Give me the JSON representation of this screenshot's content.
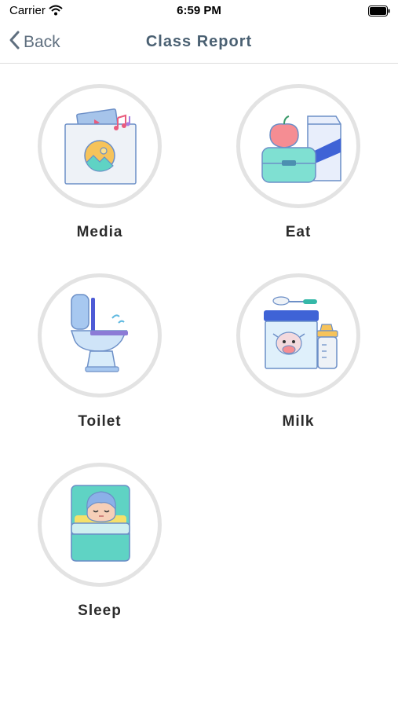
{
  "status": {
    "carrier": "Carrier",
    "time": "6:59 PM"
  },
  "nav": {
    "back_label": "Back",
    "title": "Class Report"
  },
  "tiles": [
    {
      "label": "Media",
      "icon": "media-folder-icon"
    },
    {
      "label": "Eat",
      "icon": "lunch-box-icon"
    },
    {
      "label": "Toilet",
      "icon": "toilet-icon"
    },
    {
      "label": "Milk",
      "icon": "milk-formula-icon"
    },
    {
      "label": "Sleep",
      "icon": "sleeping-baby-icon"
    }
  ]
}
